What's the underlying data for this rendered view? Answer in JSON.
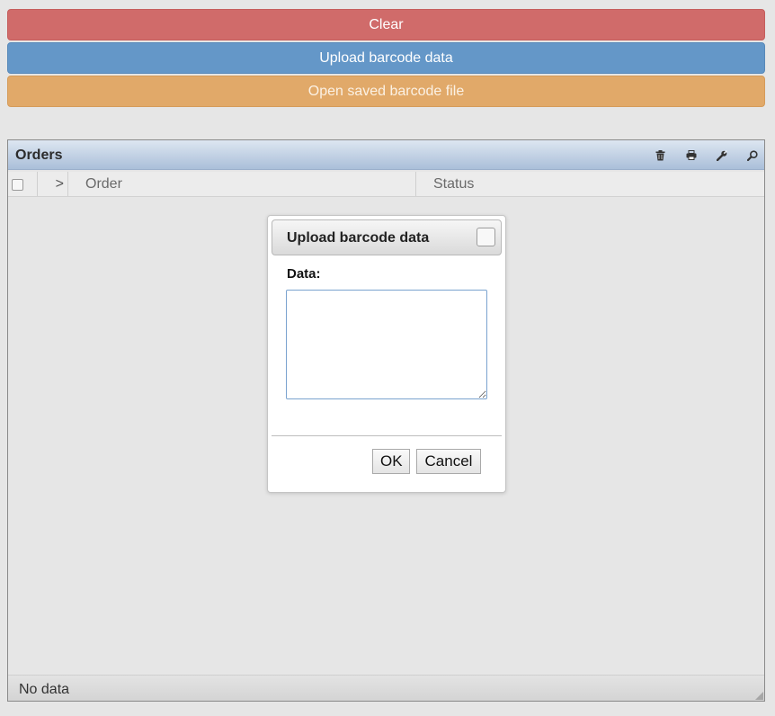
{
  "toolbar": {
    "clear_label": "Clear",
    "upload_label": "Upload barcode data",
    "open_label": "Open saved barcode file"
  },
  "grid": {
    "title": "Orders",
    "tools": [
      "trash-icon",
      "print-icon",
      "wrench-icon",
      "search-icon"
    ],
    "columns": {
      "expand": ">",
      "order": "Order",
      "status": "Status"
    },
    "footer_text": "No data"
  },
  "dialog": {
    "title": "Upload barcode data",
    "data_label": "Data:",
    "data_value": "",
    "ok_label": "OK",
    "cancel_label": "Cancel"
  },
  "colors": {
    "clear": "#d06b6a",
    "upload": "#6497c8",
    "open": "#e1a969",
    "caption": "#aabfd9"
  }
}
